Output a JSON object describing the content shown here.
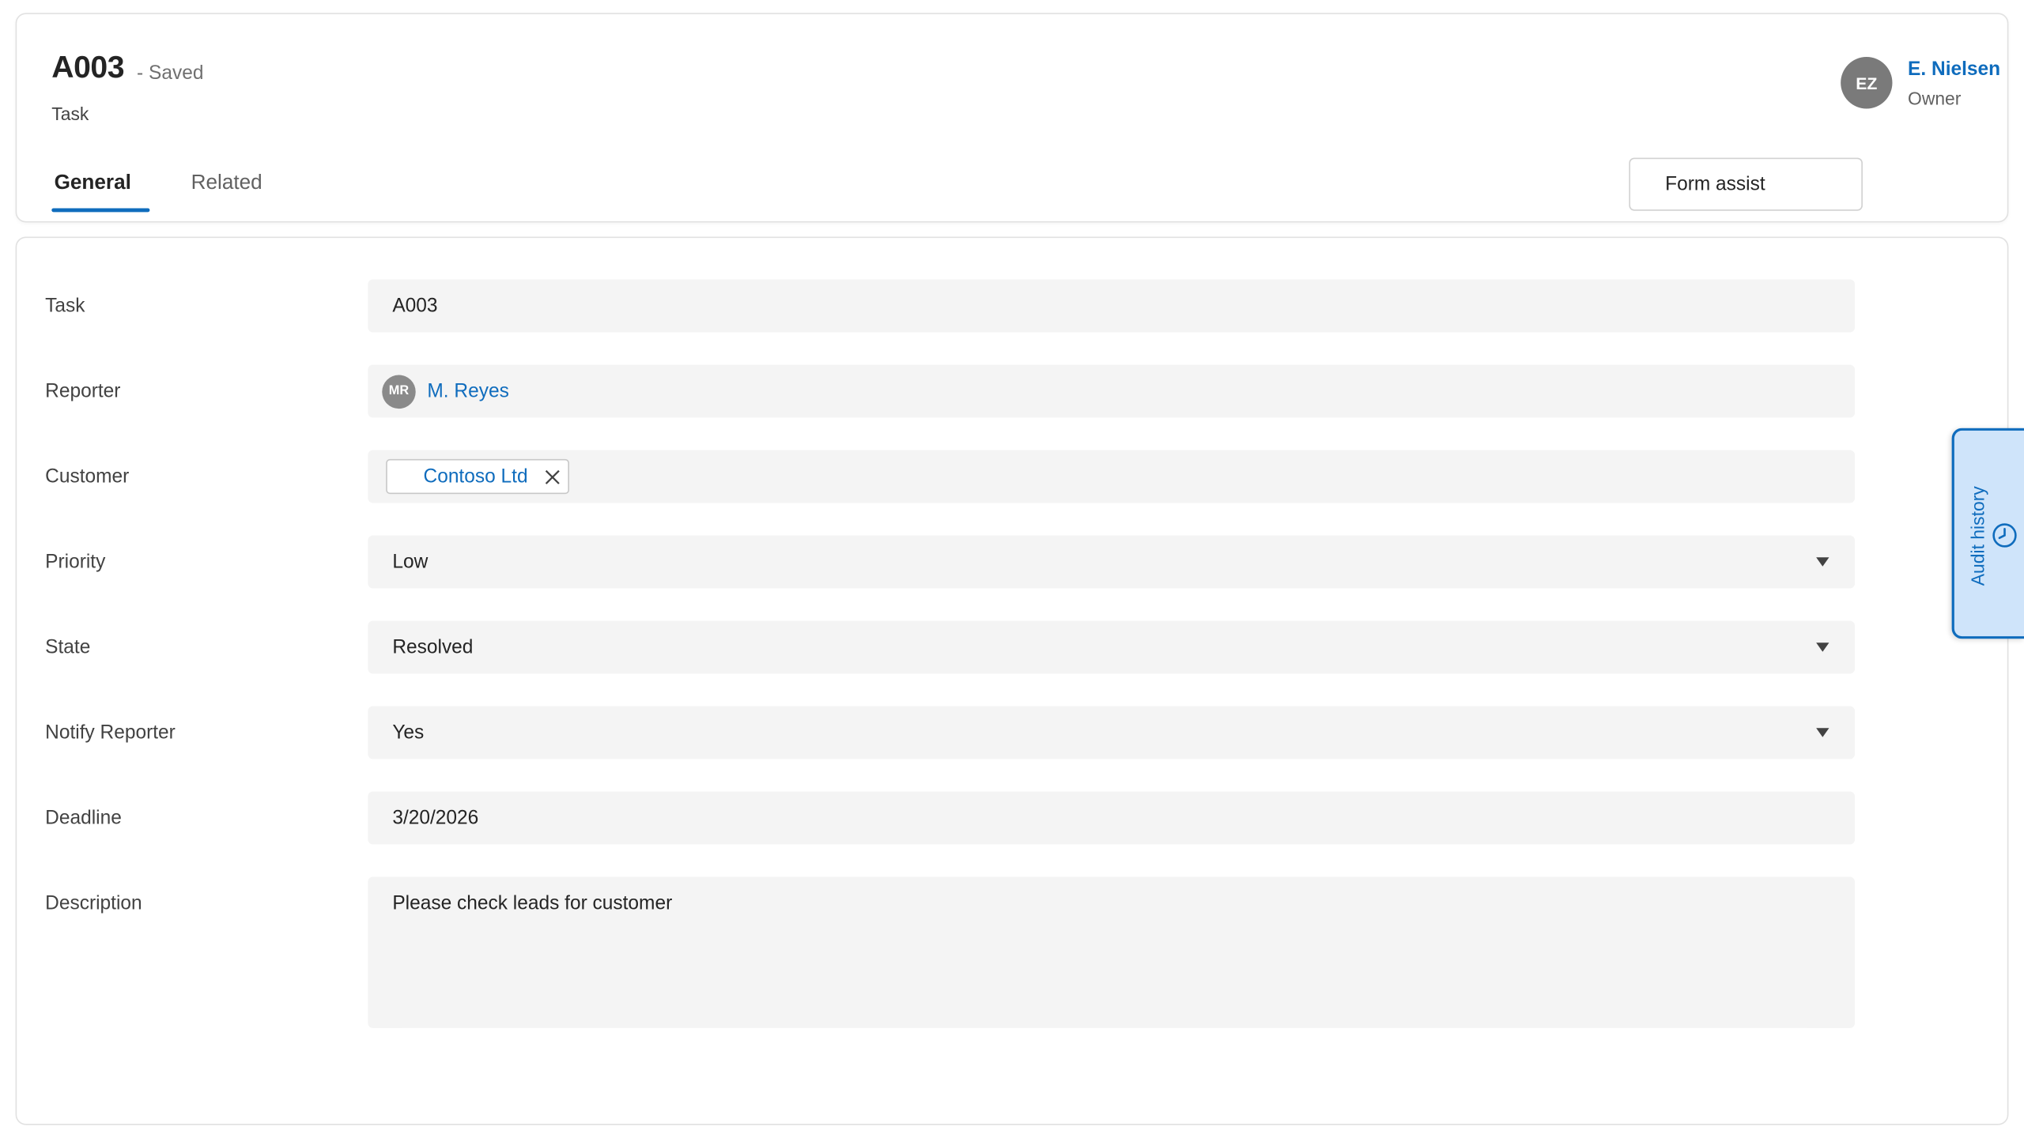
{
  "header": {
    "title": "A003",
    "status": "- Saved",
    "entity_type": "Task",
    "tabs": [
      {
        "label": "General",
        "selected": true
      },
      {
        "label": "Related",
        "selected": false
      }
    ],
    "form_assist_label": "Form assist",
    "owner": {
      "initials": "EZ",
      "name": "E. Nielsen",
      "role": "Owner"
    }
  },
  "form": {
    "task": {
      "label": "Task",
      "value": "A003"
    },
    "reporter": {
      "label": "Reporter",
      "initials": "MR",
      "value": "M. Reyes"
    },
    "customer": {
      "label": "Customer",
      "value": "Contoso Ltd"
    },
    "priority": {
      "label": "Priority",
      "value": "Low"
    },
    "state": {
      "label": "State",
      "value": "Resolved"
    },
    "notify_reporter": {
      "label": "Notify Reporter",
      "value": "Yes"
    },
    "deadline": {
      "label": "Deadline",
      "value": "3/20/2026"
    },
    "description": {
      "label": "Description",
      "value": "Please check leads for customer"
    }
  },
  "side_panel": {
    "audit_label": "Audit history",
    "icon": "clock-icon"
  },
  "colors": {
    "accent": "#0f6cbd",
    "field_bg": "#f4f4f4",
    "audit_bg": "#cfe4fa"
  }
}
